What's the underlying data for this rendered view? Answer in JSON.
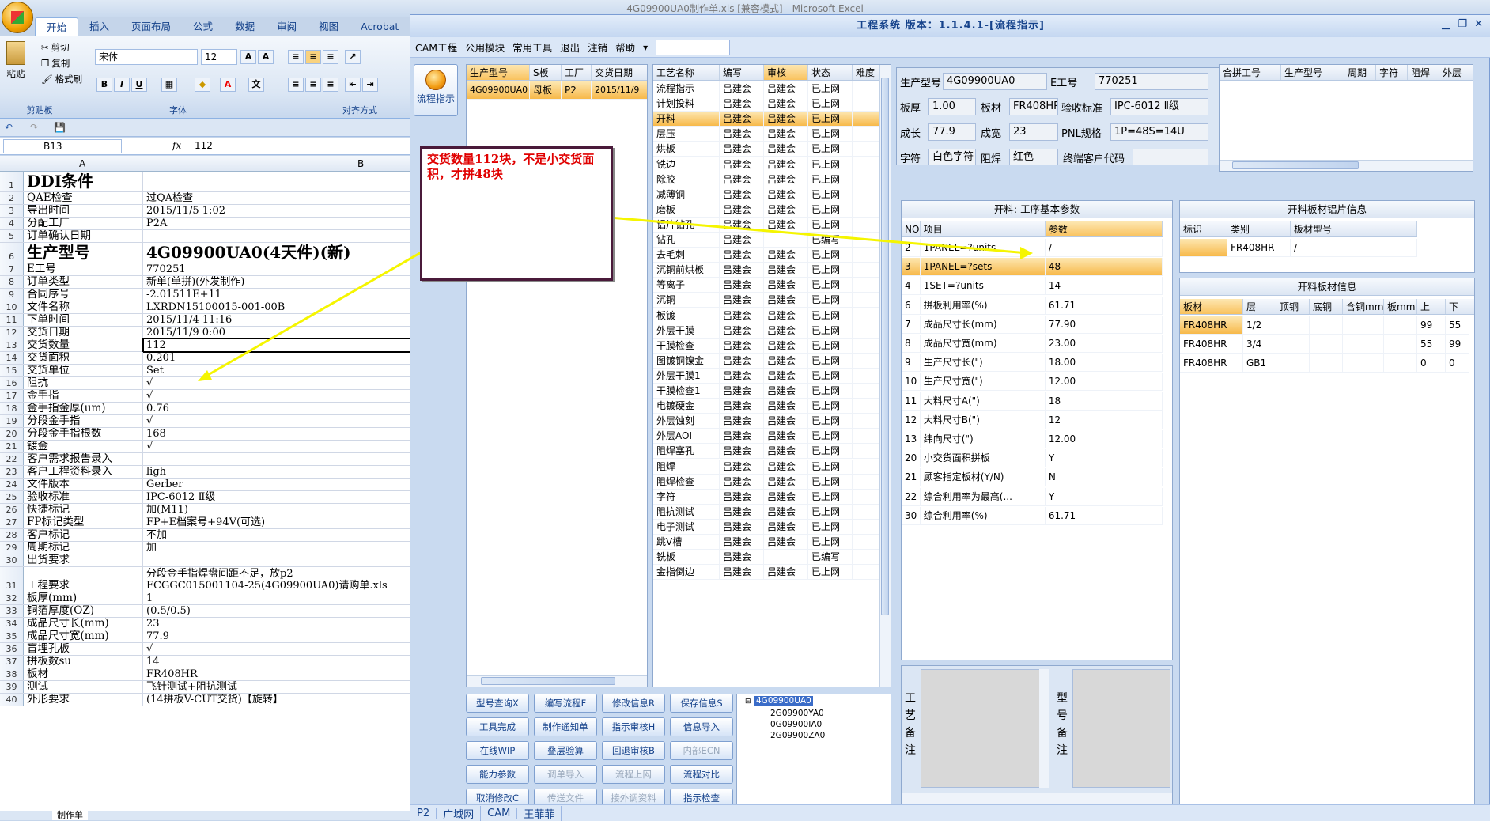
{
  "excel": {
    "title": "4G09900UA0制作单.xls  [兼容模式] - Microsoft Excel",
    "ribbon_tabs": [
      "开始",
      "插入",
      "页面布局",
      "公式",
      "数据",
      "审阅",
      "视图",
      "Acrobat"
    ],
    "clipboard": {
      "paste": "粘贴",
      "cut": "剪切",
      "copy": "复制",
      "format_painter": "格式刷",
      "group": "剪贴板"
    },
    "font": {
      "name": "宋体",
      "size": "12",
      "group": "字体"
    },
    "align_group": "对齐方式",
    "name_box": "B13",
    "fx": "fx",
    "formula": "112",
    "col_a": "A",
    "col_b": "B",
    "rows": [
      {
        "n": "1",
        "a": "DDI条件",
        "b": "",
        "big": true
      },
      {
        "n": "2",
        "a": "QAE检查",
        "b": "过QA检查"
      },
      {
        "n": "3",
        "a": "导出时间",
        "b": "2015/11/5 1:02"
      },
      {
        "n": "4",
        "a": "分配工厂",
        "b": "P2A"
      },
      {
        "n": "5",
        "a": "订单确认日期",
        "b": ""
      },
      {
        "n": "6",
        "a": "生产型号",
        "b": "4G09900UA0(4天件)(新)",
        "big": true
      },
      {
        "n": "7",
        "a": "E工号",
        "b": "770251"
      },
      {
        "n": "8",
        "a": "订单类型",
        "b": "新单(单拼)(外发制作)"
      },
      {
        "n": "9",
        "a": "合同序号",
        "b": "-2.01511E+11"
      },
      {
        "n": "10",
        "a": "文件名称",
        "b": "LXRDN15100015-001-00B"
      },
      {
        "n": "11",
        "a": "下单时间",
        "b": "2015/11/4 11:16"
      },
      {
        "n": "12",
        "a": "交货日期",
        "b": "2015/11/9 0:00"
      },
      {
        "n": "13",
        "a": "交货数量",
        "b": "112"
      },
      {
        "n": "14",
        "a": "交货面积",
        "b": "0.201"
      },
      {
        "n": "15",
        "a": "交货单位",
        "b": "Set"
      },
      {
        "n": "16",
        "a": "阻抗",
        "b": "√"
      },
      {
        "n": "17",
        "a": "金手指",
        "b": "√"
      },
      {
        "n": "18",
        "a": "金手指金厚(um)",
        "b": "0.76"
      },
      {
        "n": "19",
        "a": "分段金手指",
        "b": "√"
      },
      {
        "n": "20",
        "a": "分段金手指根数",
        "b": "168"
      },
      {
        "n": "21",
        "a": "镀金",
        "b": "√"
      },
      {
        "n": "22",
        "a": "客户需求报告录入",
        "b": ""
      },
      {
        "n": "23",
        "a": "客户工程资料录入",
        "b": "ligh"
      },
      {
        "n": "24",
        "a": "文件版本",
        "b": "Gerber"
      },
      {
        "n": "25",
        "a": "验收标准",
        "b": "IPC-6012 Ⅱ级"
      },
      {
        "n": "26",
        "a": "快捷标记",
        "b": "加(M11)"
      },
      {
        "n": "27",
        "a": "FP标记类型",
        "b": "FP+E档案号+94V(可选)"
      },
      {
        "n": "28",
        "a": "客户标记",
        "b": "不加"
      },
      {
        "n": "29",
        "a": "周期标记",
        "b": "加"
      },
      {
        "n": "30",
        "a": "出货要求",
        "b": ""
      },
      {
        "n": "31",
        "a": "工程要求",
        "b": "分段金手指焊盘间距不足，放p2",
        "b2": "FCGGC015001104-25(4G09900UA0)请购单.xls"
      },
      {
        "n": "32",
        "a": "板厚(mm)",
        "b": "1"
      },
      {
        "n": "33",
        "a": "铜箔厚度(OZ)",
        "b": "(0.5/0.5)"
      },
      {
        "n": "34",
        "a": "成品尺寸长(mm)",
        "b": "23"
      },
      {
        "n": "35",
        "a": "成品尺寸宽(mm)",
        "b": "77.9"
      },
      {
        "n": "36",
        "a": "盲埋孔板",
        "b": "√"
      },
      {
        "n": "37",
        "a": "拼板数su",
        "b": "14"
      },
      {
        "n": "38",
        "a": "板材",
        "b": "FR408HR"
      },
      {
        "n": "39",
        "a": "测试",
        "b": "飞针测试+阻抗测试"
      },
      {
        "n": "40",
        "a": "外形要求",
        "b": "(14拼板V-CUT交货)【旋转】"
      }
    ],
    "sheet_tab": "制作单"
  },
  "app": {
    "title": "工程系统 版本：1.1.4.1-[流程指示]",
    "menu": [
      "CAM工程",
      "公用模块",
      "常用工具",
      "退出",
      "注销",
      "帮助"
    ],
    "flow_button": "流程指示",
    "orders": {
      "headers": [
        "生产型号",
        "S板",
        "工厂",
        "交货日期"
      ],
      "rows": [
        [
          "4G09900UA0",
          "母板",
          "P2",
          "2015/11/9"
        ]
      ]
    },
    "process": {
      "headers": [
        "工艺名称",
        "编写",
        "审核",
        "状态",
        "难度"
      ],
      "rows": [
        [
          "流程指示",
          "吕建会",
          "吕建会",
          "已上网"
        ],
        [
          "计划投料",
          "吕建会",
          "吕建会",
          "已上网"
        ],
        [
          "开料",
          "吕建会",
          "吕建会",
          "已上网"
        ],
        [
          "层压",
          "吕建会",
          "吕建会",
          "已上网"
        ],
        [
          "烘板",
          "吕建会",
          "吕建会",
          "已上网"
        ],
        [
          "铣边",
          "吕建会",
          "吕建会",
          "已上网"
        ],
        [
          "除胶",
          "吕建会",
          "吕建会",
          "已上网"
        ],
        [
          "减薄铜",
          "吕建会",
          "吕建会",
          "已上网"
        ],
        [
          "磨板",
          "吕建会",
          "吕建会",
          "已上网"
        ],
        [
          "铝片钻孔",
          "吕建会",
          "吕建会",
          "已上网"
        ],
        [
          "钻孔",
          "吕建会",
          "",
          "已编写"
        ],
        [
          "去毛刺",
          "吕建会",
          "吕建会",
          "已上网"
        ],
        [
          "沉铜前烘板",
          "吕建会",
          "吕建会",
          "已上网"
        ],
        [
          "等离子",
          "吕建会",
          "吕建会",
          "已上网"
        ],
        [
          "沉铜",
          "吕建会",
          "吕建会",
          "已上网"
        ],
        [
          "板镀",
          "吕建会",
          "吕建会",
          "已上网"
        ],
        [
          "外层干膜",
          "吕建会",
          "吕建会",
          "已上网"
        ],
        [
          "干膜检查",
          "吕建会",
          "吕建会",
          "已上网"
        ],
        [
          "图镀铜镍金",
          "吕建会",
          "吕建会",
          "已上网"
        ],
        [
          "外层干膜1",
          "吕建会",
          "吕建会",
          "已上网"
        ],
        [
          "干膜检查1",
          "吕建会",
          "吕建会",
          "已上网"
        ],
        [
          "电镀硬金",
          "吕建会",
          "吕建会",
          "已上网"
        ],
        [
          "外层蚀刻",
          "吕建会",
          "吕建会",
          "已上网"
        ],
        [
          "外层AOI",
          "吕建会",
          "吕建会",
          "已上网"
        ],
        [
          "阻焊塞孔",
          "吕建会",
          "吕建会",
          "已上网"
        ],
        [
          "阻焊",
          "吕建会",
          "吕建会",
          "已上网"
        ],
        [
          "阻焊检查",
          "吕建会",
          "吕建会",
          "已上网"
        ],
        [
          "字符",
          "吕建会",
          "吕建会",
          "已上网"
        ],
        [
          "阻抗测试",
          "吕建会",
          "吕建会",
          "已上网"
        ],
        [
          "电子测试",
          "吕建会",
          "吕建会",
          "已上网"
        ],
        [
          "跳V槽",
          "吕建会",
          "吕建会",
          "已上网"
        ],
        [
          "铣板",
          "吕建会",
          "",
          "已编写"
        ],
        [
          "金指倒边",
          "吕建会",
          "吕建会",
          "已上网"
        ]
      ]
    },
    "buttons": [
      [
        "型号查询X",
        "编写流程F",
        "修改信息R",
        "保存信息S"
      ],
      [
        "工具完成",
        "制作通知单",
        "指示审核H",
        "信息导入"
      ],
      [
        "在线WIP",
        "叠层验算",
        "回退审核B",
        "内部ECN"
      ],
      [
        "能力参数",
        "调单导入",
        "流程上网",
        "流程对比"
      ],
      [
        "取消修改C",
        "传送文件",
        "接外调资料",
        "指示检查"
      ]
    ],
    "disabled_buttons": [
      "内部ECN",
      "调单导入",
      "流程上网",
      "传送文件",
      "接外调资料"
    ],
    "tree": [
      "4G09900UA0",
      "2G09900YA0",
      "0G09900IA0",
      "2G09900ZA0"
    ],
    "info": {
      "model_label": "生产型号",
      "model": "4G09900UA0",
      "e_label": "E工号",
      "e": "770251",
      "thick_label": "板厚",
      "thick": "1.00",
      "mat_label": "板材",
      "mat": "FR408HR",
      "std_label": "验收标准",
      "std": "IPC-6012 Ⅱ级",
      "len_label": "成长",
      "len": "77.9",
      "wid_label": "成宽",
      "wid": "23",
      "pnl_label": "PNL规格",
      "pnl": "1P=48S=14U",
      "char_label": "字符",
      "char": "白色字符",
      "mask_label": "阻焊",
      "mask": "红色",
      "cust_label": "终端客户代码",
      "cust": ""
    },
    "merge": {
      "headers": [
        "合拼工号",
        "生产型号",
        "周期",
        "字符",
        "阻焊",
        "外层"
      ]
    },
    "params": {
      "title": "开料: 工序基本参数",
      "headers": [
        "NO",
        "项目",
        "参数"
      ],
      "rows": [
        [
          "2",
          "1PANEL=?units",
          "/"
        ],
        [
          "3",
          "1PANEL=?sets",
          "48"
        ],
        [
          "4",
          "1SET=?units",
          "14"
        ],
        [
          "6",
          "拼板利用率(%)",
          "61.71"
        ],
        [
          "7",
          "成品尺寸长(mm)",
          "77.90"
        ],
        [
          "8",
          "成品尺寸宽(mm)",
          "23.00"
        ],
        [
          "9",
          "生产尺寸长(\")",
          "18.00"
        ],
        [
          "10",
          "生产尺寸宽(\")",
          "12.00"
        ],
        [
          "11",
          "大料尺寸A(\")",
          "18"
        ],
        [
          "12",
          "大料尺寸B(\")",
          "12"
        ],
        [
          "13",
          "纬向尺寸(\")",
          "12.00"
        ],
        [
          "20",
          "小交货面积拼板",
          "Y"
        ],
        [
          "21",
          "顾客指定板材(Y/N)",
          "N"
        ],
        [
          "22",
          "综合利用率为最高(...",
          "Y"
        ],
        [
          "30",
          "综合利用率(%)",
          "61.71"
        ]
      ]
    },
    "foil": {
      "title": "开料板材铝片信息",
      "headers": [
        "标识",
        "类别",
        "板材型号"
      ],
      "rows": [
        [
          "",
          "FR408HR",
          "/"
        ]
      ]
    },
    "board": {
      "title": "开料板材信息",
      "headers": [
        "板材",
        "层",
        "顶铜",
        "底铜",
        "含铜mm",
        "板mm",
        "上",
        "下"
      ],
      "rows": [
        [
          "FR408HR",
          "1/2",
          "",
          "",
          "",
          "",
          "99",
          "55"
        ],
        [
          "FR408HR",
          "3/4",
          "",
          "",
          "",
          "",
          "55",
          "99"
        ],
        [
          "FR408HR",
          "GB1",
          "",
          "",
          "",
          "",
          "0",
          "0"
        ]
      ]
    },
    "remark_process": "工艺备注",
    "remark_model": "型号备注",
    "status": [
      "P2",
      "广域网",
      "CAM",
      "王菲菲"
    ]
  },
  "annotation": {
    "text": "交货数量112块，不是小交货面积，才拼48块",
    "color": "#e00000",
    "arrow_color": "#f5f500"
  }
}
